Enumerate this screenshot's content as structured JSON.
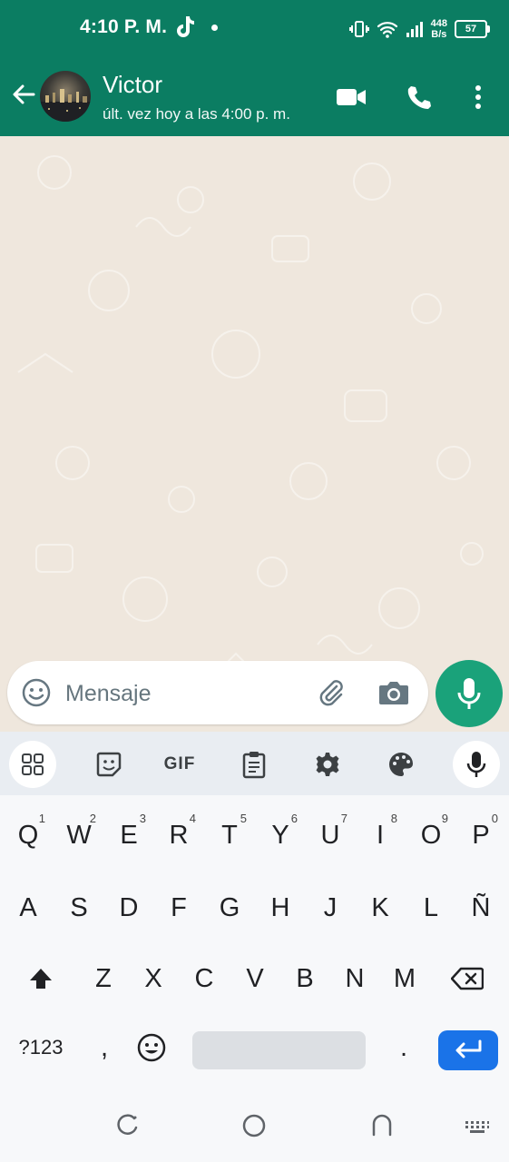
{
  "status_bar": {
    "time": "4:10 P. M.",
    "speed_value": "448",
    "speed_unit": "B/s",
    "battery": "57"
  },
  "header": {
    "contact_name": "Victor",
    "last_seen": "últ. vez hoy a las 4:00 p. m.",
    "icons": [
      "back-arrow-icon",
      "video-call-icon",
      "voice-call-icon",
      "more-options-icon"
    ]
  },
  "composer": {
    "placeholder": "Mensaje",
    "value": "",
    "icons": [
      "emoji-icon",
      "attach-icon",
      "camera-icon",
      "mic-icon"
    ]
  },
  "keyboard": {
    "toolbar": {
      "gif_label": "GIF",
      "icons": [
        "apps-grid-icon",
        "sticker-icon",
        "clipboard-icon",
        "settings-icon",
        "palette-icon",
        "mic-icon"
      ]
    },
    "row1": [
      {
        "k": "Q",
        "h": "1"
      },
      {
        "k": "W",
        "h": "2"
      },
      {
        "k": "E",
        "h": "3"
      },
      {
        "k": "R",
        "h": "4"
      },
      {
        "k": "T",
        "h": "5"
      },
      {
        "k": "Y",
        "h": "6"
      },
      {
        "k": "U",
        "h": "7"
      },
      {
        "k": "I",
        "h": "8"
      },
      {
        "k": "O",
        "h": "9"
      },
      {
        "k": "P",
        "h": "0"
      }
    ],
    "row2": [
      "A",
      "S",
      "D",
      "F",
      "G",
      "H",
      "J",
      "K",
      "L",
      "Ñ"
    ],
    "row3": [
      "Z",
      "X",
      "C",
      "V",
      "B",
      "N",
      "M"
    ],
    "row4": {
      "symbols": "?123",
      "comma": ",",
      "period": "."
    }
  },
  "colors": {
    "brand": "#0b7d62",
    "accent": "#1aa27a",
    "chat_bg": "#efe7dd",
    "enter_key": "#1a73e8"
  }
}
